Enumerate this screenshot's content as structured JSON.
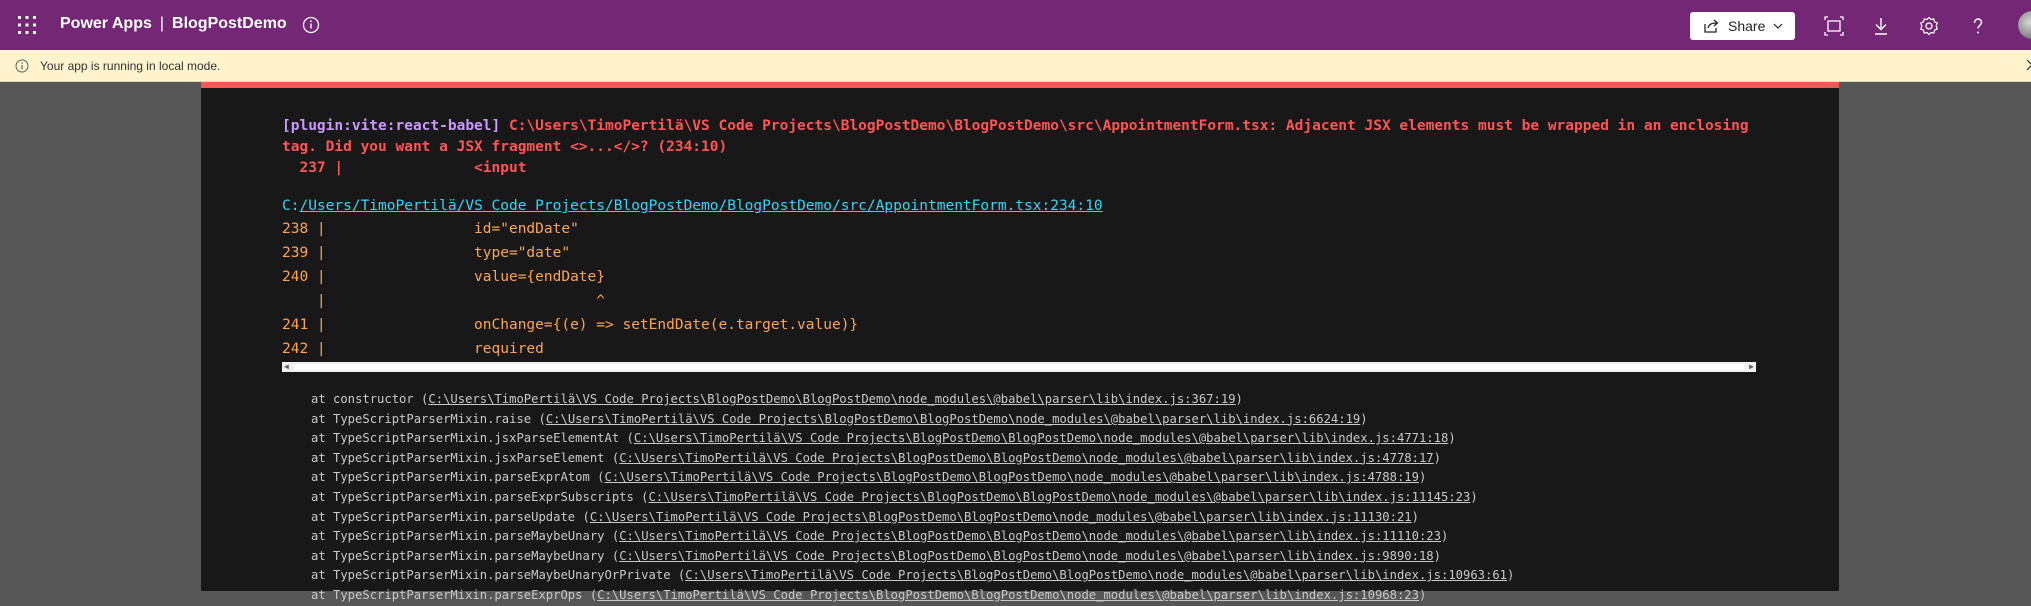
{
  "topbar": {
    "app_name": "Power Apps",
    "separator": "|",
    "project_name": "BlogPostDemo",
    "share_label": "Share",
    "icons": [
      "waffle-icon",
      "info-icon",
      "share-icon",
      "chevron-down-icon",
      "fit-screen-icon",
      "download-icon",
      "settings-icon",
      "help-icon",
      "avatar"
    ],
    "background_color": "#742774"
  },
  "banner": {
    "text": "Your app is running in local mode.",
    "background_color": "#fff4ce"
  },
  "error": {
    "plugin": "[plugin:vite:react-babel]",
    "message": " C:\\Users\\TimoPertilä\\VS Code Projects\\BlogPostDemo\\BlogPostDemo\\src\\AppointmentForm.tsx: Adjacent JSX elements must be wrapped in an enclosing tag. Did you want a JSX fragment <>...</>? (234:10)",
    "code_line": "  237 |               <input",
    "file_prefix": "C:",
    "file_path": "/Users/TimoPertilä/VS Code Projects/BlogPostDemo/BlogPostDemo/src/AppointmentForm.tsx:234:10",
    "frame": [
      "238 |                 id=\"endDate\"",
      "239 |                 type=\"date\"",
      "240 |                 value={endDate}",
      "    |                               ^",
      "241 |                 onChange={(e) => setEndDate(e.target.value)}",
      "242 |                 required"
    ],
    "stack": [
      {
        "fn": "at constructor (",
        "path": "C:\\Users\\TimoPertilä\\VS Code Projects\\BlogPostDemo\\BlogPostDemo\\node_modules\\@babel\\parser\\lib\\index.js:367:19",
        "end": ")"
      },
      {
        "fn": "at TypeScriptParserMixin.raise (",
        "path": "C:\\Users\\TimoPertilä\\VS Code Projects\\BlogPostDemo\\BlogPostDemo\\node_modules\\@babel\\parser\\lib\\index.js:6624:19",
        "end": ")"
      },
      {
        "fn": "at TypeScriptParserMixin.jsxParseElementAt (",
        "path": "C:\\Users\\TimoPertilä\\VS Code Projects\\BlogPostDemo\\BlogPostDemo\\node_modules\\@babel\\parser\\lib\\index.js:4771:18",
        "end": ")"
      },
      {
        "fn": "at TypeScriptParserMixin.jsxParseElement (",
        "path": "C:\\Users\\TimoPertilä\\VS Code Projects\\BlogPostDemo\\BlogPostDemo\\node_modules\\@babel\\parser\\lib\\index.js:4778:17",
        "end": ")"
      },
      {
        "fn": "at TypeScriptParserMixin.parseExprAtom (",
        "path": "C:\\Users\\TimoPertilä\\VS Code Projects\\BlogPostDemo\\BlogPostDemo\\node_modules\\@babel\\parser\\lib\\index.js:4788:19",
        "end": ")"
      },
      {
        "fn": "at TypeScriptParserMixin.parseExprSubscripts (",
        "path": "C:\\Users\\TimoPertilä\\VS Code Projects\\BlogPostDemo\\BlogPostDemo\\node_modules\\@babel\\parser\\lib\\index.js:11145:23",
        "end": ")"
      },
      {
        "fn": "at TypeScriptParserMixin.parseUpdate (",
        "path": "C:\\Users\\TimoPertilä\\VS Code Projects\\BlogPostDemo\\BlogPostDemo\\node_modules\\@babel\\parser\\lib\\index.js:11130:21",
        "end": ")"
      },
      {
        "fn": "at TypeScriptParserMixin.parseMaybeUnary (",
        "path": "C:\\Users\\TimoPertilä\\VS Code Projects\\BlogPostDemo\\BlogPostDemo\\node_modules\\@babel\\parser\\lib\\index.js:11110:23",
        "end": ")"
      },
      {
        "fn": "at TypeScriptParserMixin.parseMaybeUnary (",
        "path": "C:\\Users\\TimoPertilä\\VS Code Projects\\BlogPostDemo\\BlogPostDemo\\node_modules\\@babel\\parser\\lib\\index.js:9890:18",
        "end": ")"
      },
      {
        "fn": "at TypeScriptParserMixin.parseMaybeUnaryOrPrivate (",
        "path": "C:\\Users\\TimoPertilä\\VS Code Projects\\BlogPostDemo\\BlogPostDemo\\node_modules\\@babel\\parser\\lib\\index.js:10963:61",
        "end": ")"
      },
      {
        "fn": "at TypeScriptParserMixin.parseExprOps (",
        "path": "C:\\Users\\TimoPertilä\\VS Code Projects\\BlogPostDemo\\BlogPostDemo\\node_modules\\@babel\\parser\\lib\\index.js:10968:23",
        "end": ")"
      }
    ],
    "colors": {
      "plugin": "#cc99ff",
      "message": "#ff5555",
      "link": "#2dd9fe",
      "frame": "#ffa54f",
      "background": "#181818"
    }
  }
}
